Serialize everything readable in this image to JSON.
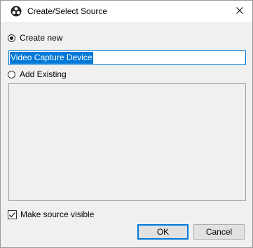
{
  "window": {
    "title": "Create/Select Source",
    "app_icon": "obs-logo-icon",
    "close_icon": "close-icon"
  },
  "options": {
    "create_new_label": "Create new",
    "create_new_selected": true,
    "add_existing_label": "Add Existing",
    "add_existing_selected": false
  },
  "source_name": {
    "value": "Video Capture Device"
  },
  "existing_sources": [],
  "make_visible": {
    "label": "Make source visible",
    "checked": true
  },
  "buttons": {
    "ok_label": "OK",
    "cancel_label": "Cancel"
  },
  "colors": {
    "accent": "#0078d7",
    "dialog_bg": "#f0f0f0"
  }
}
